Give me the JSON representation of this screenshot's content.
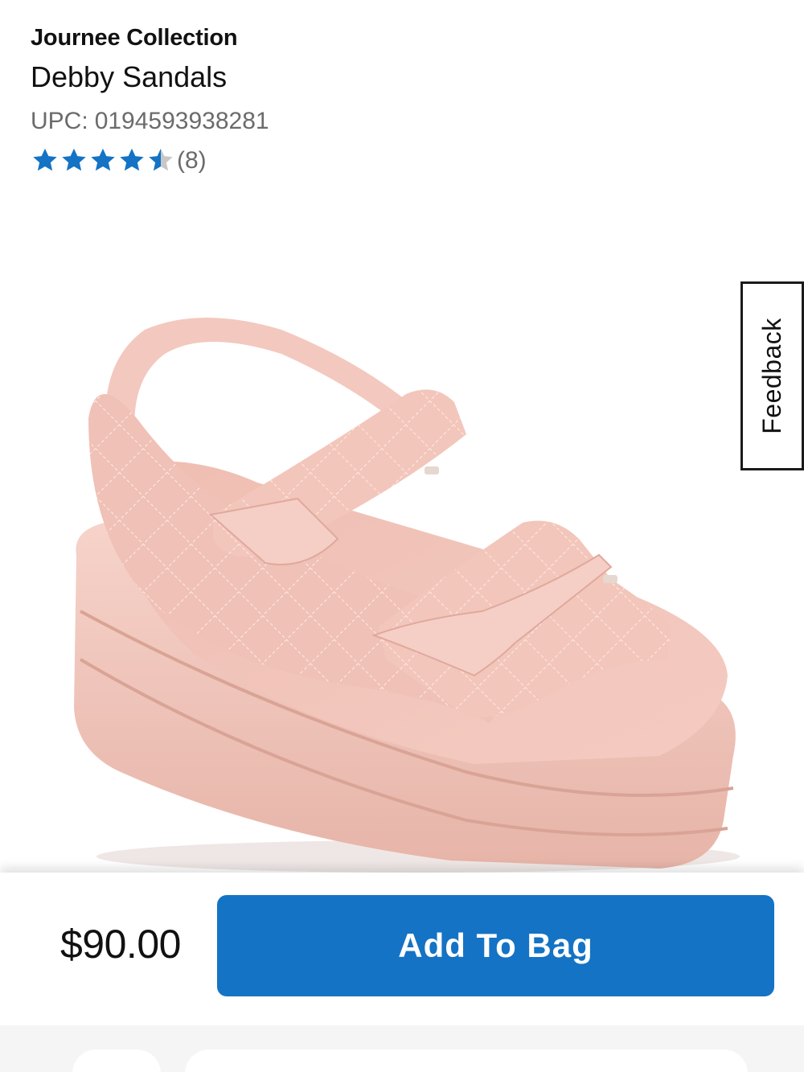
{
  "product": {
    "brand": "Journee Collection",
    "name": "Debby Sandals",
    "upc_label": "UPC:",
    "upc_value": "0194593938281",
    "rating": 4.5,
    "rating_max": 5,
    "review_count": "(8)",
    "image_alt": "Pink quilted platform sandal with two hook-and-loop straps"
  },
  "colors": {
    "star_filled": "#1473c4",
    "star_empty": "#c7c7c7",
    "button_bg": "#1473c4",
    "sandal": "#f2c7bd"
  },
  "feedback": {
    "label": "Feedback"
  },
  "purchase": {
    "price": "$90.00",
    "add_to_bag_label": "Add To Bag"
  }
}
